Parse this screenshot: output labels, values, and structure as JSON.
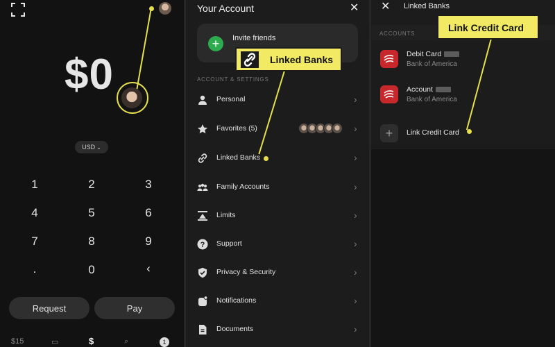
{
  "screen_home": {
    "balance": "$0",
    "currency": "USD",
    "currency_caret": "⌄",
    "keypad": [
      "1",
      "2",
      "3",
      "4",
      "5",
      "6",
      "7",
      "8",
      "9",
      ".",
      "0",
      "‹"
    ],
    "request_label": "Request",
    "pay_label": "Pay",
    "tabbar": [
      "$15",
      "▭",
      "$",
      "⌕",
      "1"
    ]
  },
  "screen_account": {
    "title": "Your Account",
    "close": "✕",
    "invite_label": "Invite friends",
    "section_label": "ACCOUNT & SETTINGS",
    "menu": [
      {
        "label": "Personal",
        "icon": "person-icon"
      },
      {
        "label": "Favorites (5)",
        "icon": "star-icon"
      },
      {
        "label": "Linked Banks",
        "icon": "link-icon"
      },
      {
        "label": "Family Accounts",
        "icon": "people-icon"
      },
      {
        "label": "Limits",
        "icon": "limits-icon"
      },
      {
        "label": "Support",
        "icon": "help-icon"
      },
      {
        "label": "Privacy & Security",
        "icon": "shield-icon"
      },
      {
        "label": "Notifications",
        "icon": "bell-icon"
      },
      {
        "label": "Documents",
        "icon": "document-icon"
      }
    ]
  },
  "screen_linked_banks": {
    "title": "Linked Banks",
    "close": "✕",
    "section_label": "ACCOUNTS",
    "accounts": [
      {
        "name": "Debit Card",
        "bank": "Bank of America"
      },
      {
        "name": "Account",
        "bank": "Bank of America"
      }
    ],
    "add_card_label": "Link Credit Card"
  },
  "callouts": {
    "linked_banks": "Linked Banks",
    "link_credit_card": "Link Credit Card"
  },
  "colors": {
    "highlight": "#f1ea62",
    "invite_green": "#2eab4e",
    "bank_red": "#c8282c",
    "background": "#121212"
  }
}
